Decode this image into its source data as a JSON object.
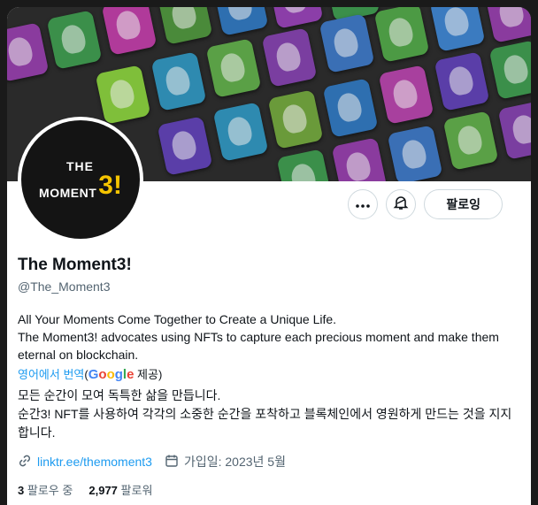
{
  "profile": {
    "display_name": "The Moment3!",
    "handle": "@The_Moment3",
    "bio_en_line1": "All Your Moments Come Together to Create a Unique Life.",
    "bio_en_line2": "The Moment3! advocates using NFTs to capture each precious moment and make them eternal on blockchain.",
    "translate_link": "영어에서 번역",
    "translate_open": "(",
    "translate_brand": "Google",
    "translate_close": "제공)",
    "bio_ko_line1": "모든 순간이 모여 독특한 삶을 만듭니다.",
    "bio_ko_line2": "순간3! NFT를 사용하여 각각의 소중한 순간을 포착하고 블록체인에서 영원하게 만드는 것을 지지합니다.",
    "link_text": "linktr.ee/themoment3",
    "joined": "가입일: 2023년 5월",
    "following_count": "3",
    "following_label": "팔로우 중",
    "followers_count": "2,977",
    "followers_label": "팔로워"
  },
  "avatar_logo": {
    "line1": "THE",
    "line2": "MOMENT",
    "mark": "3!"
  },
  "actions": {
    "more_icon": "more-icon",
    "bell_icon": "bell-icon",
    "follow_label": "팔로잉"
  },
  "colors": {
    "accent": "#1d9bf0",
    "logo_yellow": "#f5c400"
  }
}
